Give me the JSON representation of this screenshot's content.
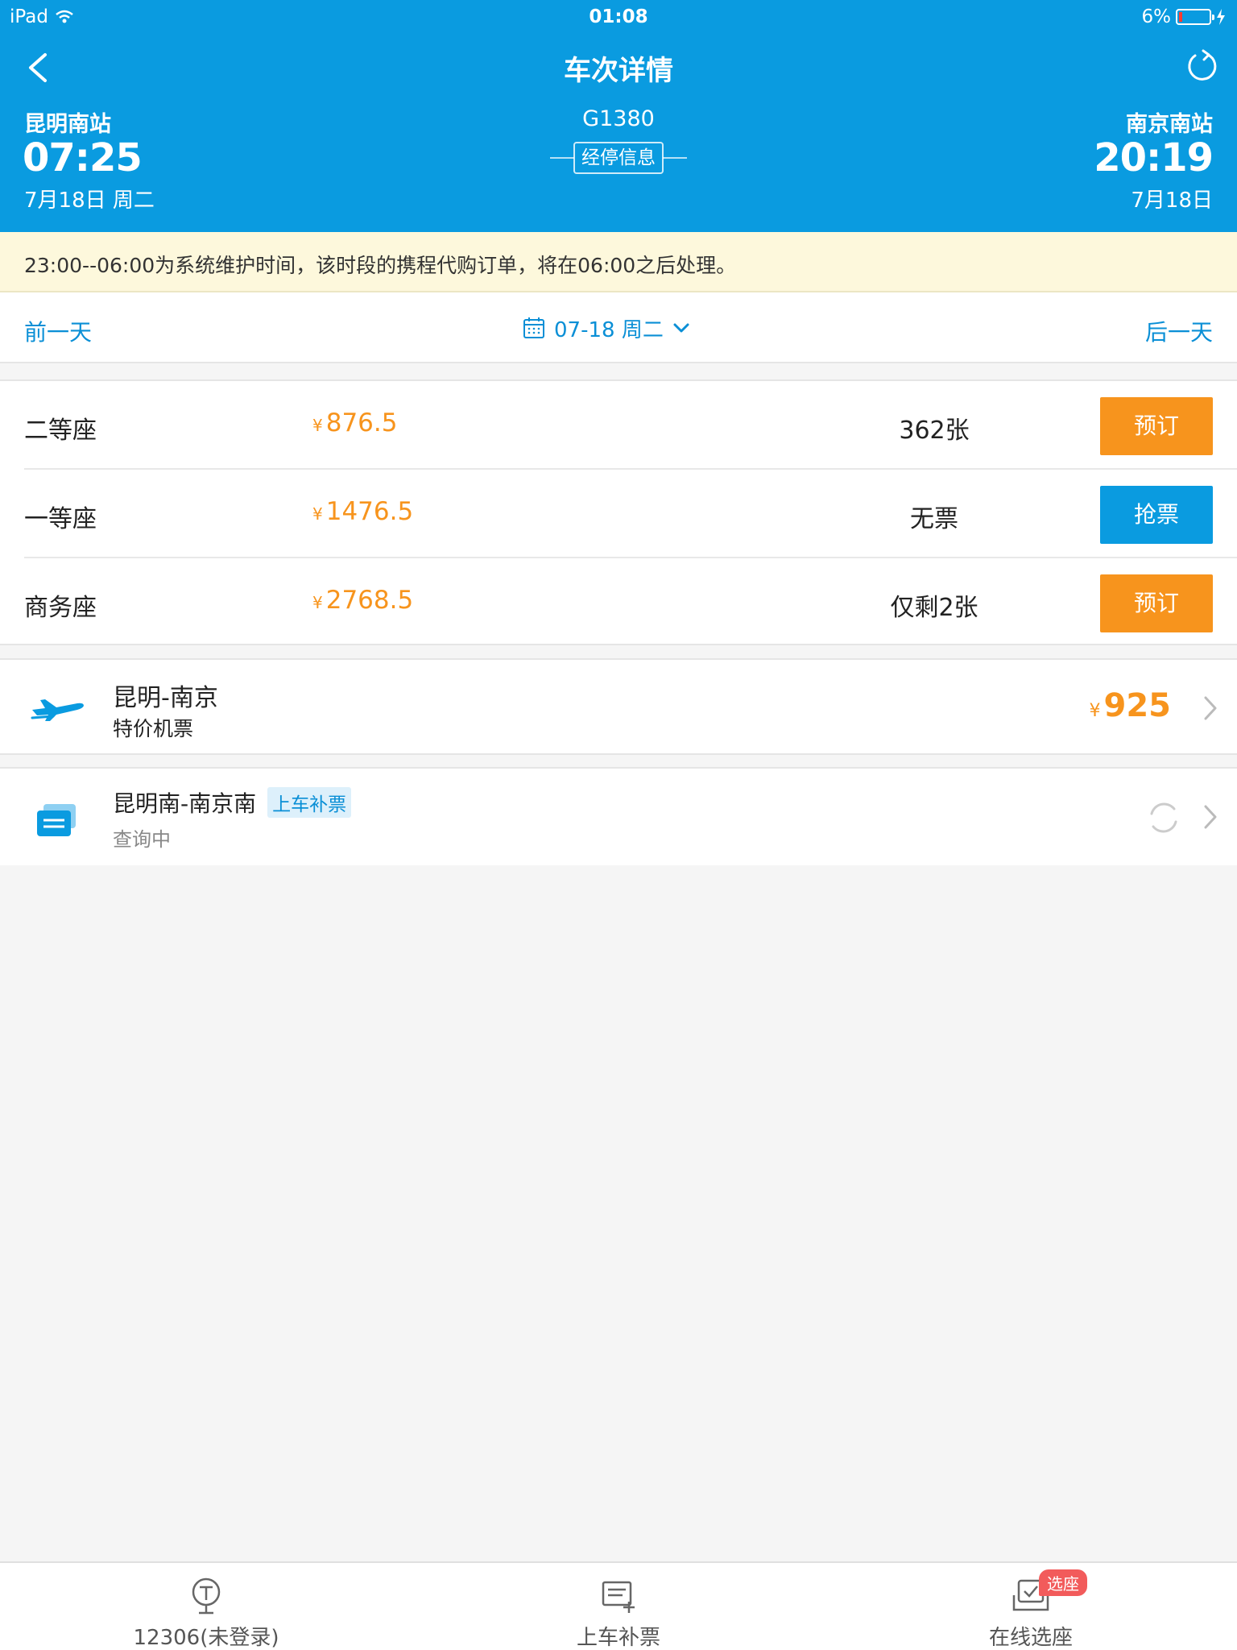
{
  "status_bar": {
    "device": "iPad",
    "time": "01:08",
    "battery": "6%"
  },
  "header": {
    "title": "车次详情",
    "from": {
      "station": "昆明南站",
      "time": "07:25",
      "date": "7月18日 周二"
    },
    "to": {
      "station": "南京南站",
      "time": "20:19",
      "date": "7月18日"
    },
    "train_no": "G1380",
    "stop_info_label": "经停信息"
  },
  "notice": {
    "text": "23:00--06:00为系统维护时间，该时段的携程代购订单，将在06:00之后处理。"
  },
  "date_nav": {
    "prev_label": "前一天",
    "next_label": "后一天",
    "current_date": "07-18 周二"
  },
  "seats": [
    {
      "name": "二等座",
      "currency": "¥",
      "price": "876.5",
      "stock": "362张",
      "action": "预订"
    },
    {
      "name": "一等座",
      "currency": "¥",
      "price": "1476.5",
      "stock": "无票",
      "action": "抢票"
    },
    {
      "name": "商务座",
      "currency": "¥",
      "price": "2768.5",
      "stock": "仅剩2张",
      "action": "预订"
    }
  ],
  "flight": {
    "route": "昆明-南京",
    "subtitle": "特价机票",
    "currency": "¥",
    "price": "925"
  },
  "supplement": {
    "route": "昆明南-南京南",
    "tag": "上车补票",
    "status": "查询中"
  },
  "tabbar": {
    "items": [
      {
        "label": "12306(未登录)",
        "icon": "train-icon"
      },
      {
        "label": "上车补票",
        "icon": "ticket-add-icon"
      },
      {
        "label": "在线选座",
        "icon": "seat-select-icon",
        "badge": "选座"
      }
    ]
  },
  "colors": {
    "primary": "#0a9be0",
    "accent": "#f7941d",
    "notice_bg": "#fdf8dc",
    "badge": "#f25b5b"
  }
}
